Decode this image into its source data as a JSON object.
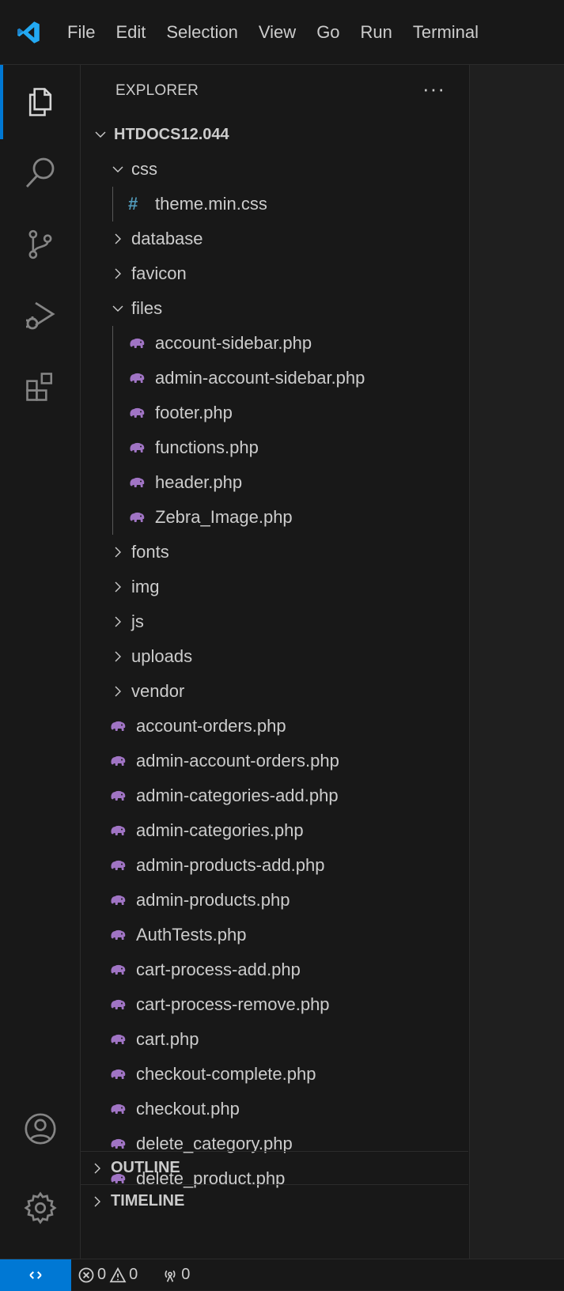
{
  "menu": [
    "File",
    "Edit",
    "Selection",
    "View",
    "Go",
    "Run",
    "Terminal"
  ],
  "explorer": {
    "title": "EXPLORER",
    "more": "···",
    "root": "HTDOCS12.044",
    "tree": [
      {
        "label": "HTDOCS12.044",
        "type": "root",
        "depth": 0
      },
      {
        "label": "css",
        "type": "folder-open",
        "depth": 1
      },
      {
        "label": "theme.min.css",
        "type": "css",
        "depth": 2
      },
      {
        "label": "database",
        "type": "folder",
        "depth": 1
      },
      {
        "label": "favicon",
        "type": "folder",
        "depth": 1
      },
      {
        "label": "files",
        "type": "folder-open",
        "depth": 1
      },
      {
        "label": "account-sidebar.php",
        "type": "php",
        "depth": 2
      },
      {
        "label": "admin-account-sidebar.php",
        "type": "php",
        "depth": 2
      },
      {
        "label": "footer.php",
        "type": "php",
        "depth": 2
      },
      {
        "label": "functions.php",
        "type": "php",
        "depth": 2
      },
      {
        "label": "header.php",
        "type": "php",
        "depth": 2
      },
      {
        "label": "Zebra_Image.php",
        "type": "php",
        "depth": 2
      },
      {
        "label": "fonts",
        "type": "folder",
        "depth": 1
      },
      {
        "label": "img",
        "type": "folder",
        "depth": 1
      },
      {
        "label": "js",
        "type": "folder",
        "depth": 1
      },
      {
        "label": "uploads",
        "type": "folder",
        "depth": 1
      },
      {
        "label": "vendor",
        "type": "folder",
        "depth": 1
      },
      {
        "label": "account-orders.php",
        "type": "php",
        "depth": 1
      },
      {
        "label": "admin-account-orders.php",
        "type": "php",
        "depth": 1
      },
      {
        "label": "admin-categories-add.php",
        "type": "php",
        "depth": 1
      },
      {
        "label": "admin-categories.php",
        "type": "php",
        "depth": 1
      },
      {
        "label": "admin-products-add.php",
        "type": "php",
        "depth": 1
      },
      {
        "label": "admin-products.php",
        "type": "php",
        "depth": 1
      },
      {
        "label": "AuthTests.php",
        "type": "php",
        "depth": 1
      },
      {
        "label": "cart-process-add.php",
        "type": "php",
        "depth": 1
      },
      {
        "label": "cart-process-remove.php",
        "type": "php",
        "depth": 1
      },
      {
        "label": "cart.php",
        "type": "php",
        "depth": 1
      },
      {
        "label": "checkout-complete.php",
        "type": "php",
        "depth": 1
      },
      {
        "label": "checkout.php",
        "type": "php",
        "depth": 1
      },
      {
        "label": "delete_category.php",
        "type": "php",
        "depth": 1
      },
      {
        "label": "delete_product.php",
        "type": "php",
        "depth": 1
      }
    ]
  },
  "panels": {
    "outline": "OUTLINE",
    "timeline": "TIMELINE"
  },
  "status": {
    "errors": "0",
    "warnings": "0",
    "ports": "0"
  },
  "colors": {
    "accent": "#0078d4",
    "php_icon": "#a074c4",
    "css_icon": "#519aba",
    "vscode_logo": "#23a9f2"
  },
  "icons": {
    "activity": [
      "explorer-icon",
      "search-icon",
      "source-control-icon",
      "run-debug-icon",
      "extensions-icon",
      "account-icon",
      "manage-gear-icon"
    ]
  }
}
